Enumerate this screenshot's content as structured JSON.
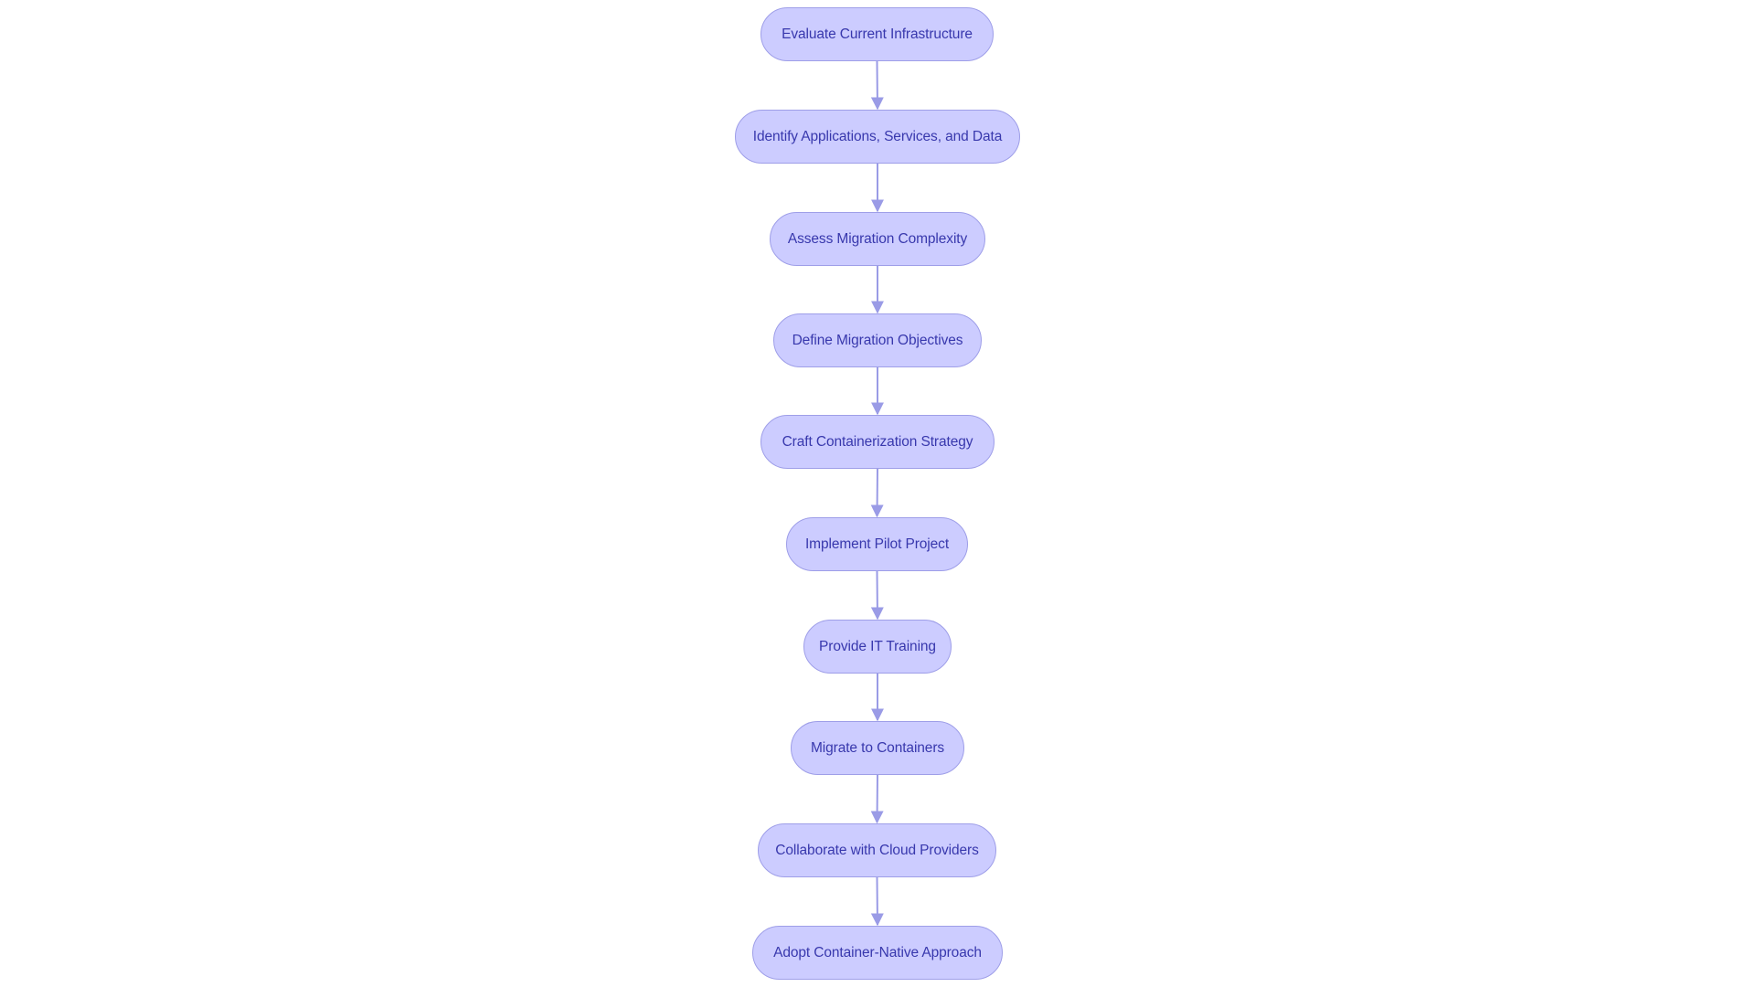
{
  "diagram": {
    "type": "flowchart",
    "direction": "top-to-bottom",
    "colors": {
      "node_fill": "#ccccff",
      "node_border": "#9e9ee8",
      "node_text": "#3838ad",
      "edge": "#9a9be6",
      "background": "#ffffff"
    },
    "nodes": [
      {
        "id": "n1",
        "label": "Evaluate Current Infrastructure"
      },
      {
        "id": "n2",
        "label": "Identify Applications, Services, and Data"
      },
      {
        "id": "n3",
        "label": "Assess Migration Complexity"
      },
      {
        "id": "n4",
        "label": "Define Migration Objectives"
      },
      {
        "id": "n5",
        "label": "Craft Containerization Strategy"
      },
      {
        "id": "n6",
        "label": "Implement Pilot Project"
      },
      {
        "id": "n7",
        "label": "Provide IT Training"
      },
      {
        "id": "n8",
        "label": "Migrate to Containers"
      },
      {
        "id": "n9",
        "label": "Collaborate with Cloud Providers"
      },
      {
        "id": "n10",
        "label": "Adopt Container-Native Approach"
      }
    ],
    "edges": [
      {
        "from": "n1",
        "to": "n2"
      },
      {
        "from": "n2",
        "to": "n3"
      },
      {
        "from": "n3",
        "to": "n4"
      },
      {
        "from": "n4",
        "to": "n5"
      },
      {
        "from": "n5",
        "to": "n6"
      },
      {
        "from": "n6",
        "to": "n7"
      },
      {
        "from": "n7",
        "to": "n8"
      },
      {
        "from": "n8",
        "to": "n9"
      },
      {
        "from": "n9",
        "to": "n10"
      }
    ]
  }
}
